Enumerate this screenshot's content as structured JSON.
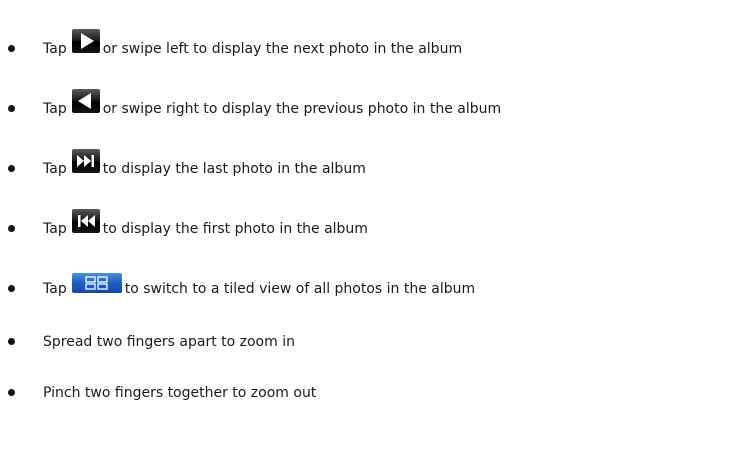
{
  "instructions": [
    {
      "before": "Tap",
      "icon": "play-next-icon",
      "after": "or swipe left to display the next photo in the album"
    },
    {
      "before": "Tap",
      "icon": "play-previous-icon",
      "after": "or swipe right to display the previous photo in the album"
    },
    {
      "before": "Tap",
      "icon": "skip-to-last-icon",
      "after": "to display the last photo in the album"
    },
    {
      "before": "Tap",
      "icon": "skip-to-first-icon",
      "after": "to display the first photo in the album"
    },
    {
      "before": "Tap",
      "icon": "tiled-view-icon",
      "after": "to switch to a tiled view of all photos in the album"
    },
    {
      "before": "",
      "icon": "",
      "after": "Spread two fingers apart to zoom in"
    },
    {
      "before": "",
      "icon": "",
      "after": "Pinch two fingers together to zoom out"
    }
  ],
  "colors": {
    "text": "#1a1a1a",
    "button_dark": "#000000",
    "button_blue": "#1f5fc0"
  }
}
